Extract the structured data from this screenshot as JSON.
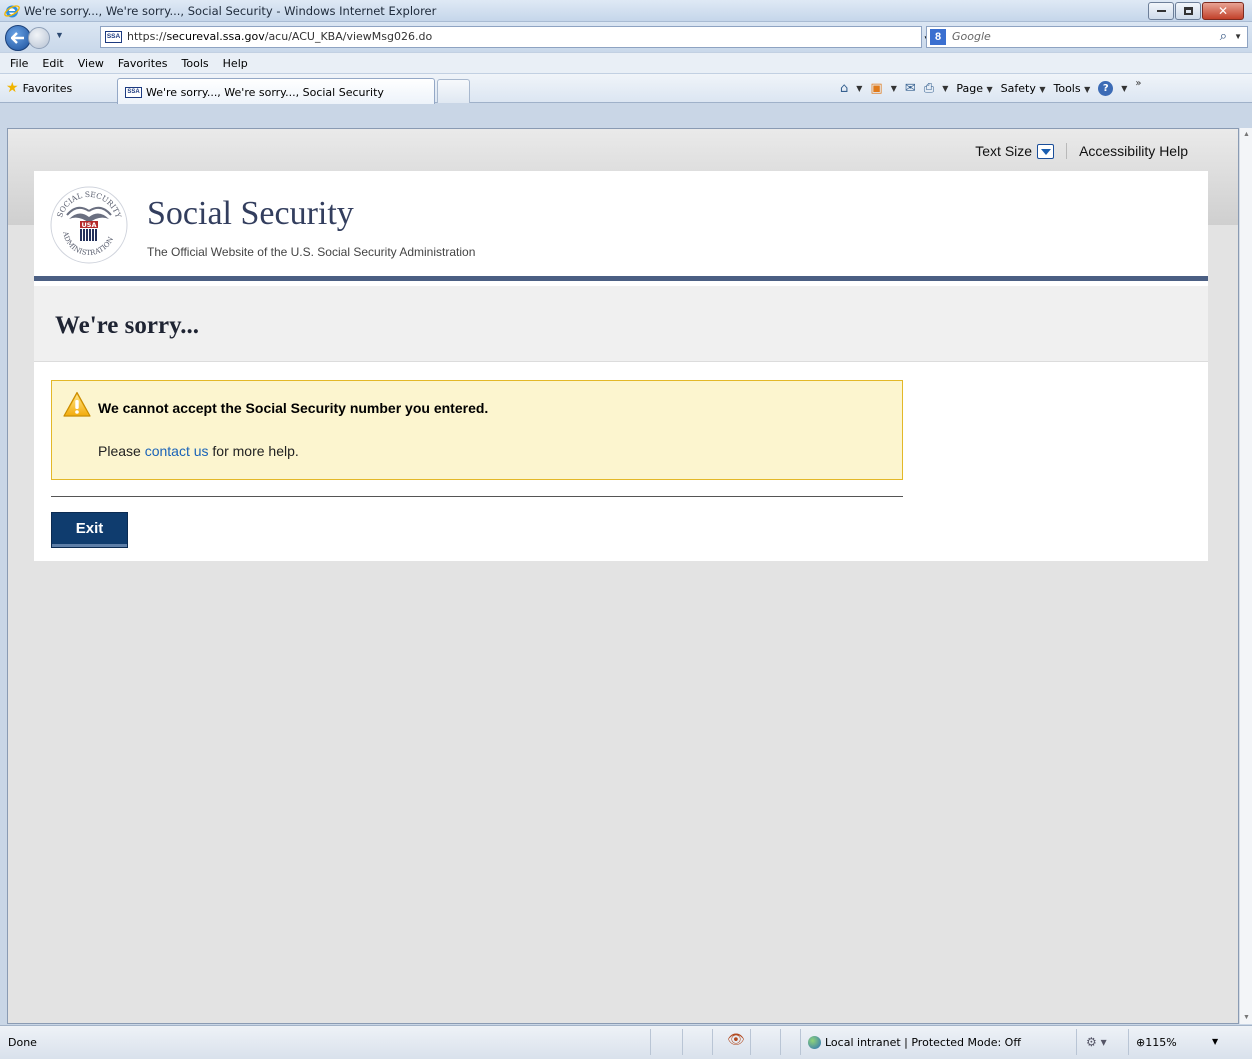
{
  "browser": {
    "window_title": "We're sorry..., We're sorry..., Social Security - Windows Internet Explorer",
    "url_prefix": "https://",
    "url_domain": "secureval.ssa.gov",
    "url_path": "/acu/ACU_KBA/viewMsg026.do",
    "search_placeholder": "Google",
    "menu": [
      "File",
      "Edit",
      "View",
      "Favorites",
      "Tools",
      "Help"
    ],
    "favorites_label": "Favorites",
    "tab_label": "We're sorry..., We're sorry..., Social Security",
    "favicon_text": "SSA",
    "command_bar": {
      "page": "Page",
      "safety": "Safety",
      "tools": "Tools"
    },
    "status_text": "Done",
    "zone_text": "Local intranet | Protected Mode: Off",
    "zoom_level": "115%"
  },
  "utility": {
    "text_size_label": "Text Size",
    "accessibility_label": "Accessibility Help"
  },
  "header": {
    "site_title": "Social Security",
    "site_subtitle": "The Official Website of the U.S. Social Security Administration",
    "seal_text": "SOCIAL SECURITY ADMINISTRATION USA"
  },
  "main": {
    "page_heading": "We're sorry...",
    "alert_message": "We cannot accept the Social Security number you entered.",
    "help_prefix": "Please ",
    "help_link": "contact us",
    "help_suffix": " for more help.",
    "exit_label": "Exit"
  },
  "colors": {
    "brand_navy": "#0f3c6e",
    "header_rule": "#4b5f83",
    "alert_bg": "#fcf5cf",
    "alert_border": "#e3b828",
    "link": "#1a63b8"
  }
}
